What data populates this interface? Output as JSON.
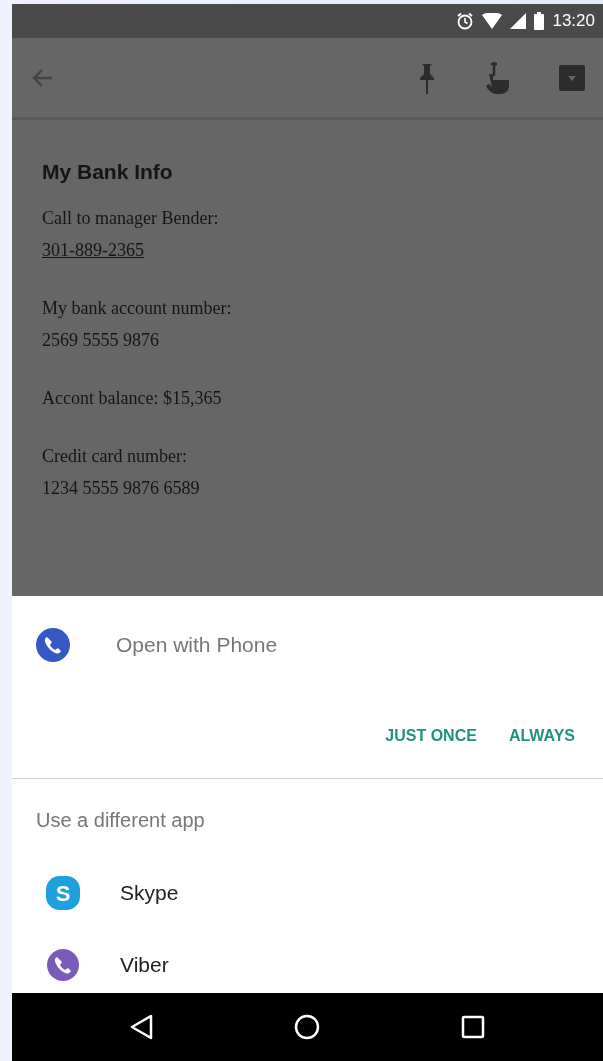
{
  "status_bar": {
    "time": "13:20"
  },
  "note": {
    "title": "My Bank Info",
    "blocks": [
      {
        "lines": [
          {
            "kind": "text",
            "text": "Call to manager Bender:"
          },
          {
            "kind": "link",
            "text": "301-889-2365"
          }
        ]
      },
      {
        "lines": [
          {
            "kind": "text",
            "text": "My bank account number:"
          },
          {
            "kind": "text",
            "text": "2569 5555 9876"
          }
        ]
      },
      {
        "lines": [
          {
            "kind": "text",
            "text": "Accont balance: $15,365"
          }
        ]
      },
      {
        "lines": [
          {
            "kind": "text",
            "text": "Credit card number:"
          },
          {
            "kind": "text",
            "text": "1234 5555 9876 6589"
          }
        ]
      }
    ]
  },
  "chooser": {
    "default_app": "Open with Phone",
    "buttons": [
      "JUST ONCE",
      "ALWAYS"
    ],
    "section_label": "Use a different app",
    "apps": [
      {
        "name": "Skype",
        "kind": "letter",
        "glyph": "S",
        "color": "#1ea0dc"
      },
      {
        "name": "Viber",
        "kind": "handset",
        "color": "#7b5bb8"
      }
    ]
  }
}
